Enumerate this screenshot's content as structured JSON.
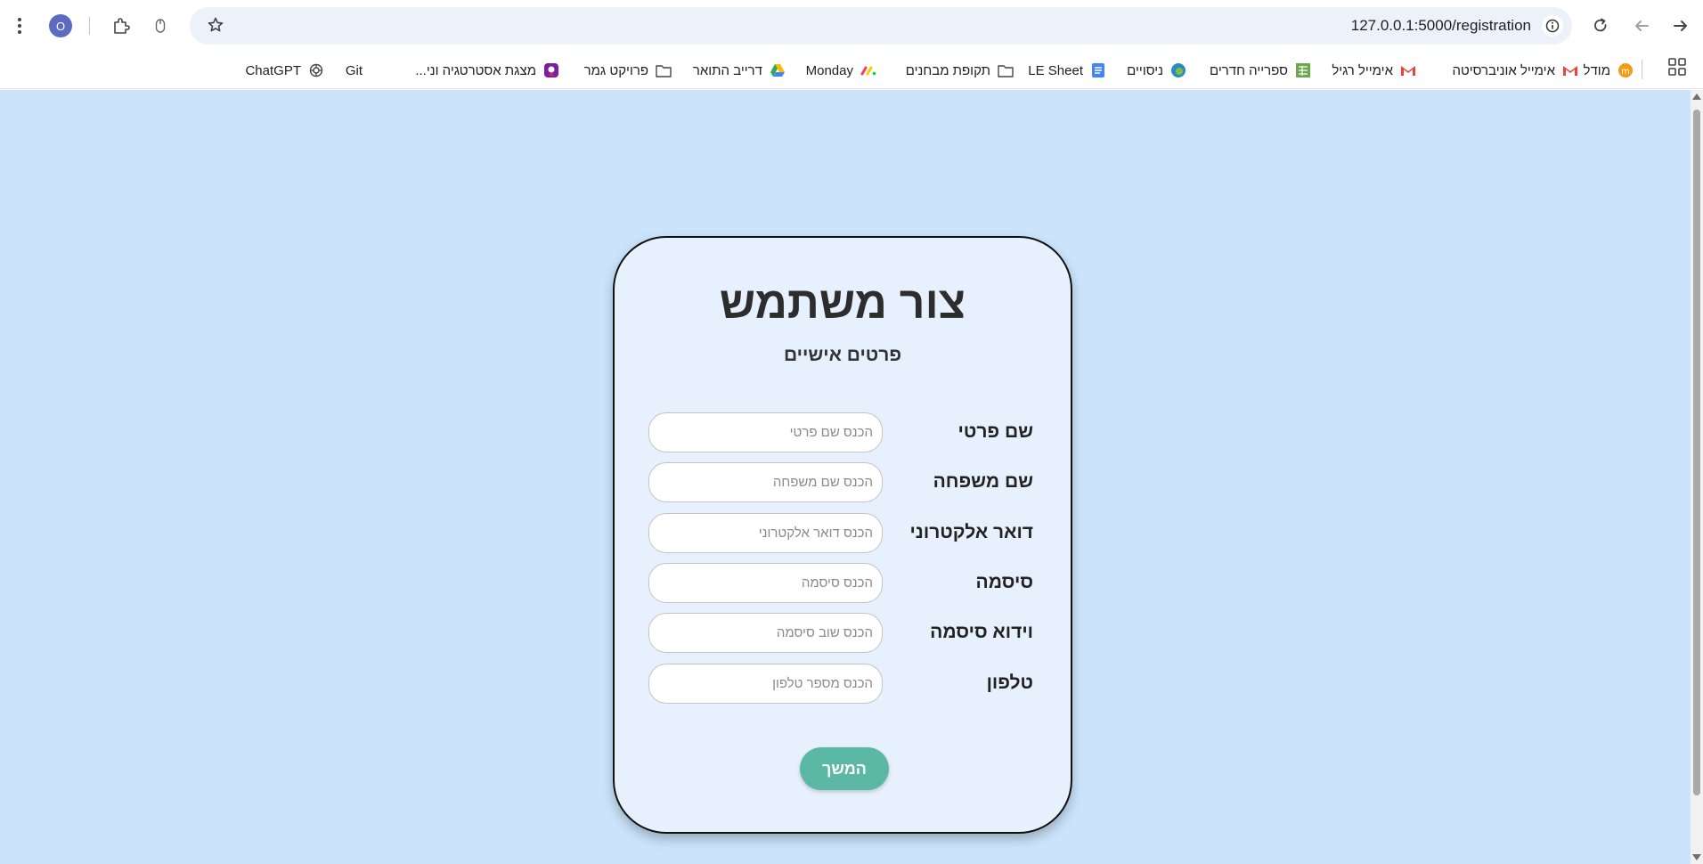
{
  "browser": {
    "url": "127.0.0.1:5000/registration",
    "profile_initial": "O",
    "icons": {
      "forward": "arrow-right-icon",
      "back": "arrow-left-icon",
      "reload": "reload-icon",
      "site_info": "info-icon",
      "bookmark": "star-icon",
      "extensions": "puzzle-icon",
      "mouse": "mouse-icon",
      "menu": "kebab-menu-icon",
      "apps": "apps-grid-icon"
    }
  },
  "bookmarks": [
    {
      "label": "מודל",
      "icon": "moodle-icon",
      "color": "#f39c12"
    },
    {
      "label": "אימייל אוניברסיטה",
      "icon": "gmail-icon",
      "color": "#ea4335"
    },
    {
      "label": "אימייל רגיל",
      "icon": "gmail-icon",
      "color": "#ea4335"
    },
    {
      "label": "ספרייה חדרים",
      "icon": "spreadsheet-icon",
      "color": "#6aa84f"
    },
    {
      "label": "ניסויים",
      "icon": "edge-icon",
      "color": "#2e8bc0"
    },
    {
      "label": "LE Sheet",
      "icon": "docs-icon",
      "color": "#4285f4"
    },
    {
      "label": "תקופת מבחנים",
      "icon": "folder-icon",
      "color": "#444444"
    },
    {
      "label": "Monday",
      "icon": "monday-icon",
      "color": "#ff3d57"
    },
    {
      "label": "דרייב התואר",
      "icon": "drive-icon",
      "color": "#34a853"
    },
    {
      "label": "פרויקט גמר",
      "icon": "folder-icon",
      "color": "#444444"
    },
    {
      "label": "מצגת אסטרטגיה וני...",
      "icon": "presentation-icon",
      "color": "#7b1fa2"
    },
    {
      "label": "Git",
      "icon": "",
      "color": ""
    },
    {
      "label": "ChatGPT",
      "icon": "chatgpt-icon",
      "color": "#444444"
    }
  ],
  "form": {
    "title": "צור משתמש",
    "subtitle": "פרטים אישיים",
    "fields": [
      {
        "label": "שם פרטי",
        "placeholder": "הכנס שם פרטי",
        "value": ""
      },
      {
        "label": "שם משפחה",
        "placeholder": "הכנס שם משפחה",
        "value": ""
      },
      {
        "label": "דואר אלקטרוני",
        "placeholder": "הכנס דואר אלקטרוני",
        "value": ""
      },
      {
        "label": "סיסמה",
        "placeholder": "הכנס סיסמה",
        "value": ""
      },
      {
        "label": "וידוא סיסמה",
        "placeholder": "הכנס שוב סיסמה",
        "value": ""
      },
      {
        "label": "טלפון",
        "placeholder": "הכנס מספר טלפון",
        "value": ""
      }
    ],
    "submit_label": "המשך"
  },
  "colors": {
    "page_background": "#cbe4fb",
    "card_background": "#e6f1fd",
    "button": "#5bb8a4"
  }
}
